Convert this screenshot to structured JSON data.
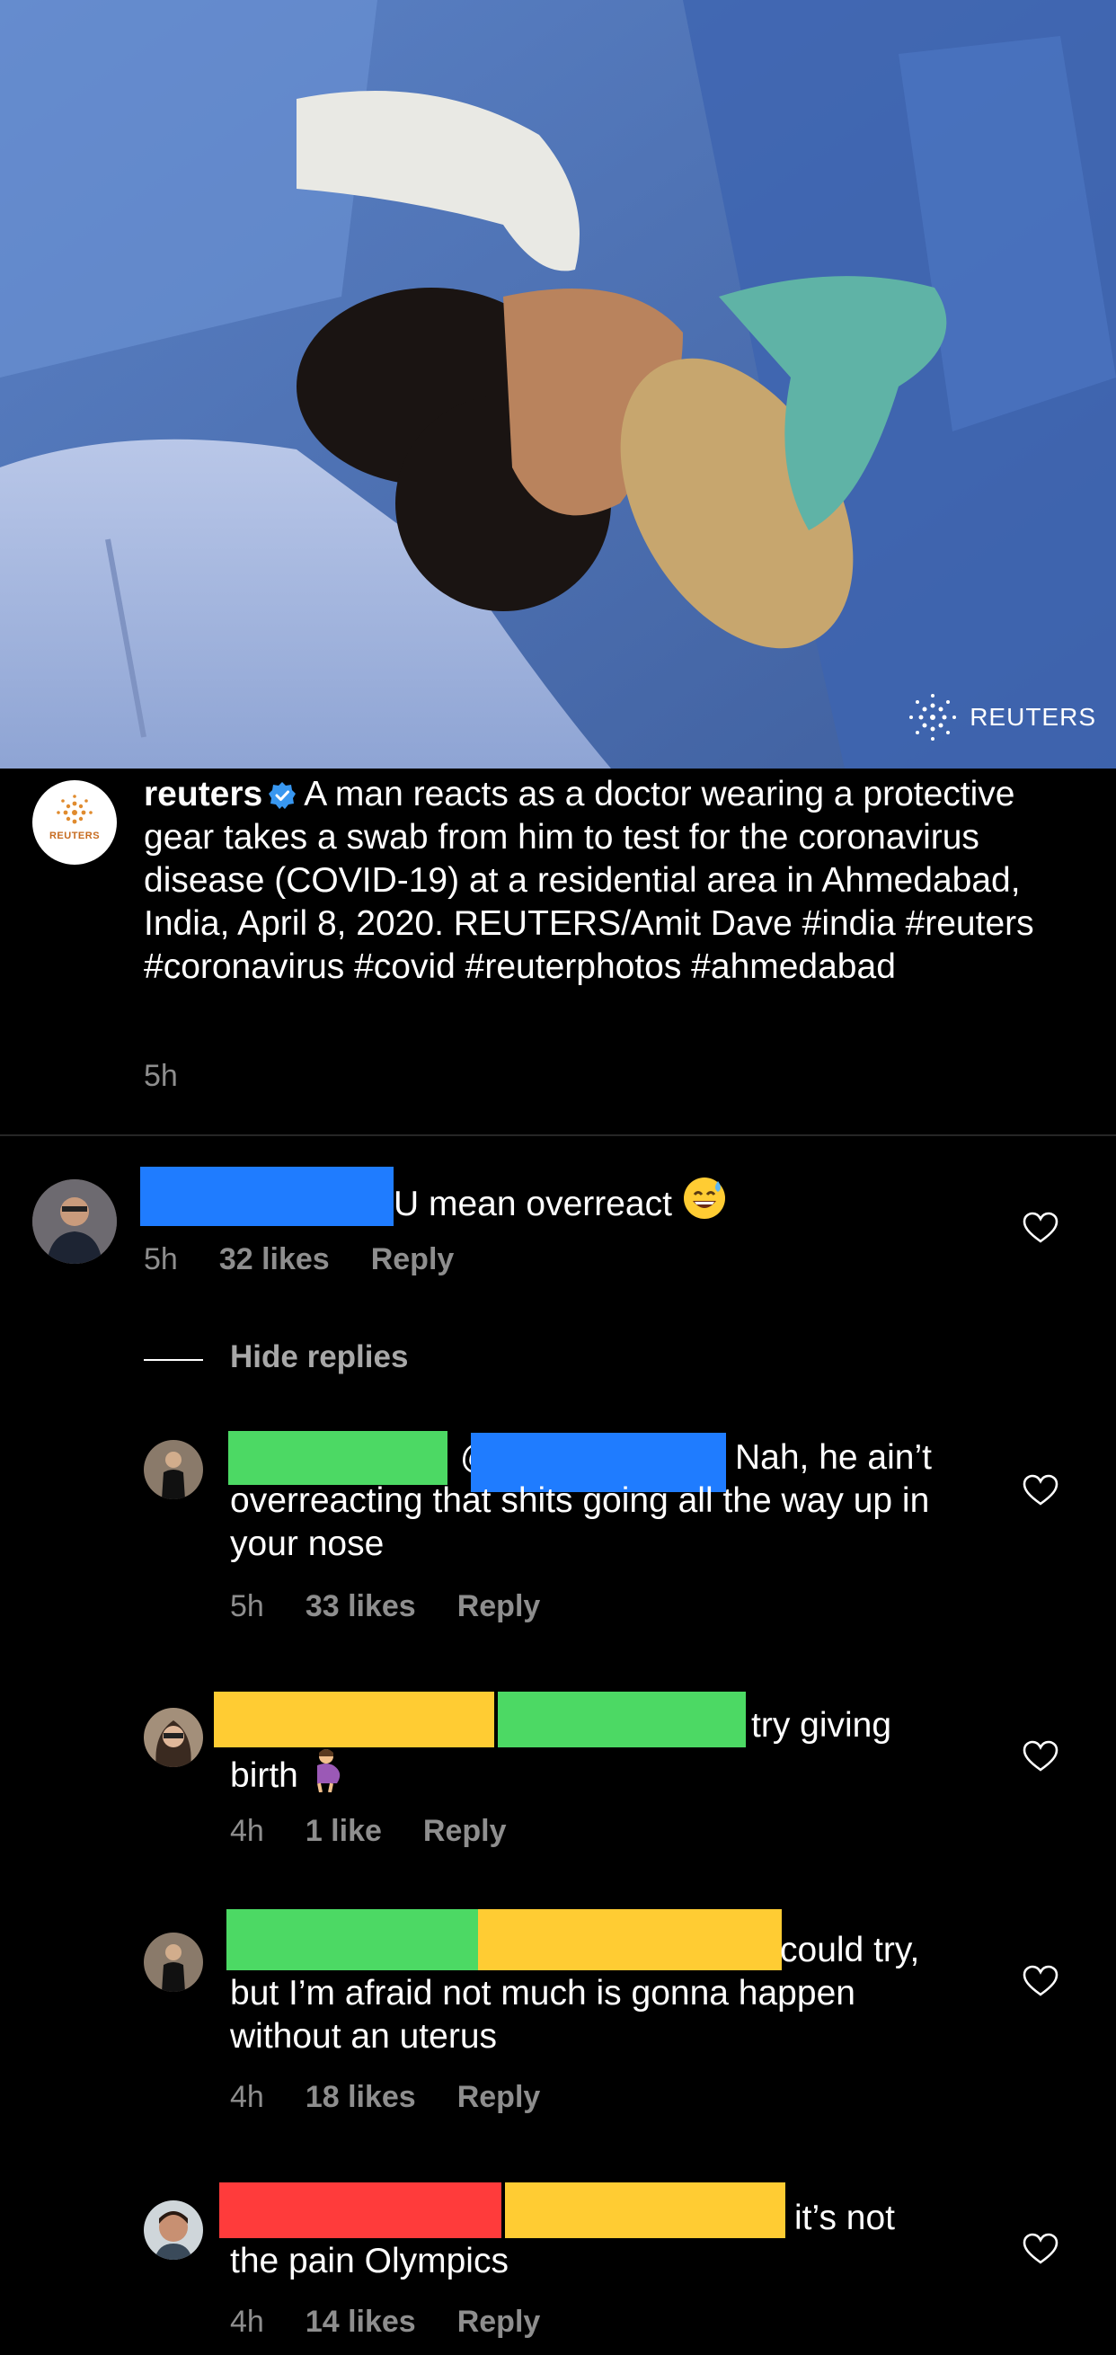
{
  "photo": {
    "watermark": "REUTERS"
  },
  "post": {
    "username": "reuters",
    "avatar_label": "REUTERS",
    "caption": "A man reacts as a doctor wearing a protective gear takes a swab from him to test for the coronavirus disease (COVID-19) at a residential area in Ahmedabad, India, April 8, 2020. REUTERS/Amit Dave  #india #reuters #coronavirus #covid #reuterphotos #ahmedabad",
    "time": "5h",
    "verified": true
  },
  "colors": {
    "redact_blue": "#1f7cff",
    "redact_green": "#4cd964",
    "redact_yellow": "#ffcc33",
    "redact_red": "#ff3b3b",
    "meta_gray": "#8e8e8e"
  },
  "comments": [
    {
      "text": "U mean overreact",
      "emoji": "grinning-sweat-emoji",
      "time": "5h",
      "likes": "32 likes",
      "reply": "Reply",
      "redactions": [
        "blue"
      ]
    }
  ],
  "thread": {
    "hide_replies": "Hide replies"
  },
  "replies": [
    {
      "mention": "@",
      "text_line1": "Nah, he ain’t",
      "text_rest": "overreacting that shits going all the way up in your nose",
      "time": "5h",
      "likes": "33 likes",
      "reply": "Reply",
      "redactions": [
        "green",
        "blue"
      ]
    },
    {
      "text_line1": "try giving",
      "text_rest": "birth",
      "emoji": "pregnant-woman-emoji",
      "time": "4h",
      "likes": "1 like",
      "reply": "Reply",
      "redactions": [
        "yellow",
        "green"
      ]
    },
    {
      "text_line1": "could try,",
      "text_rest": "but I’m afraid not much is gonna happen without an uterus",
      "time": "4h",
      "likes": "18 likes",
      "reply": "Reply",
      "redactions": [
        "green",
        "yellow"
      ]
    },
    {
      "text_line1": "it’s not",
      "text_rest": "the pain Olympics",
      "time": "4h",
      "likes": "14 likes",
      "reply": "Reply",
      "redactions": [
        "red",
        "yellow"
      ]
    }
  ]
}
